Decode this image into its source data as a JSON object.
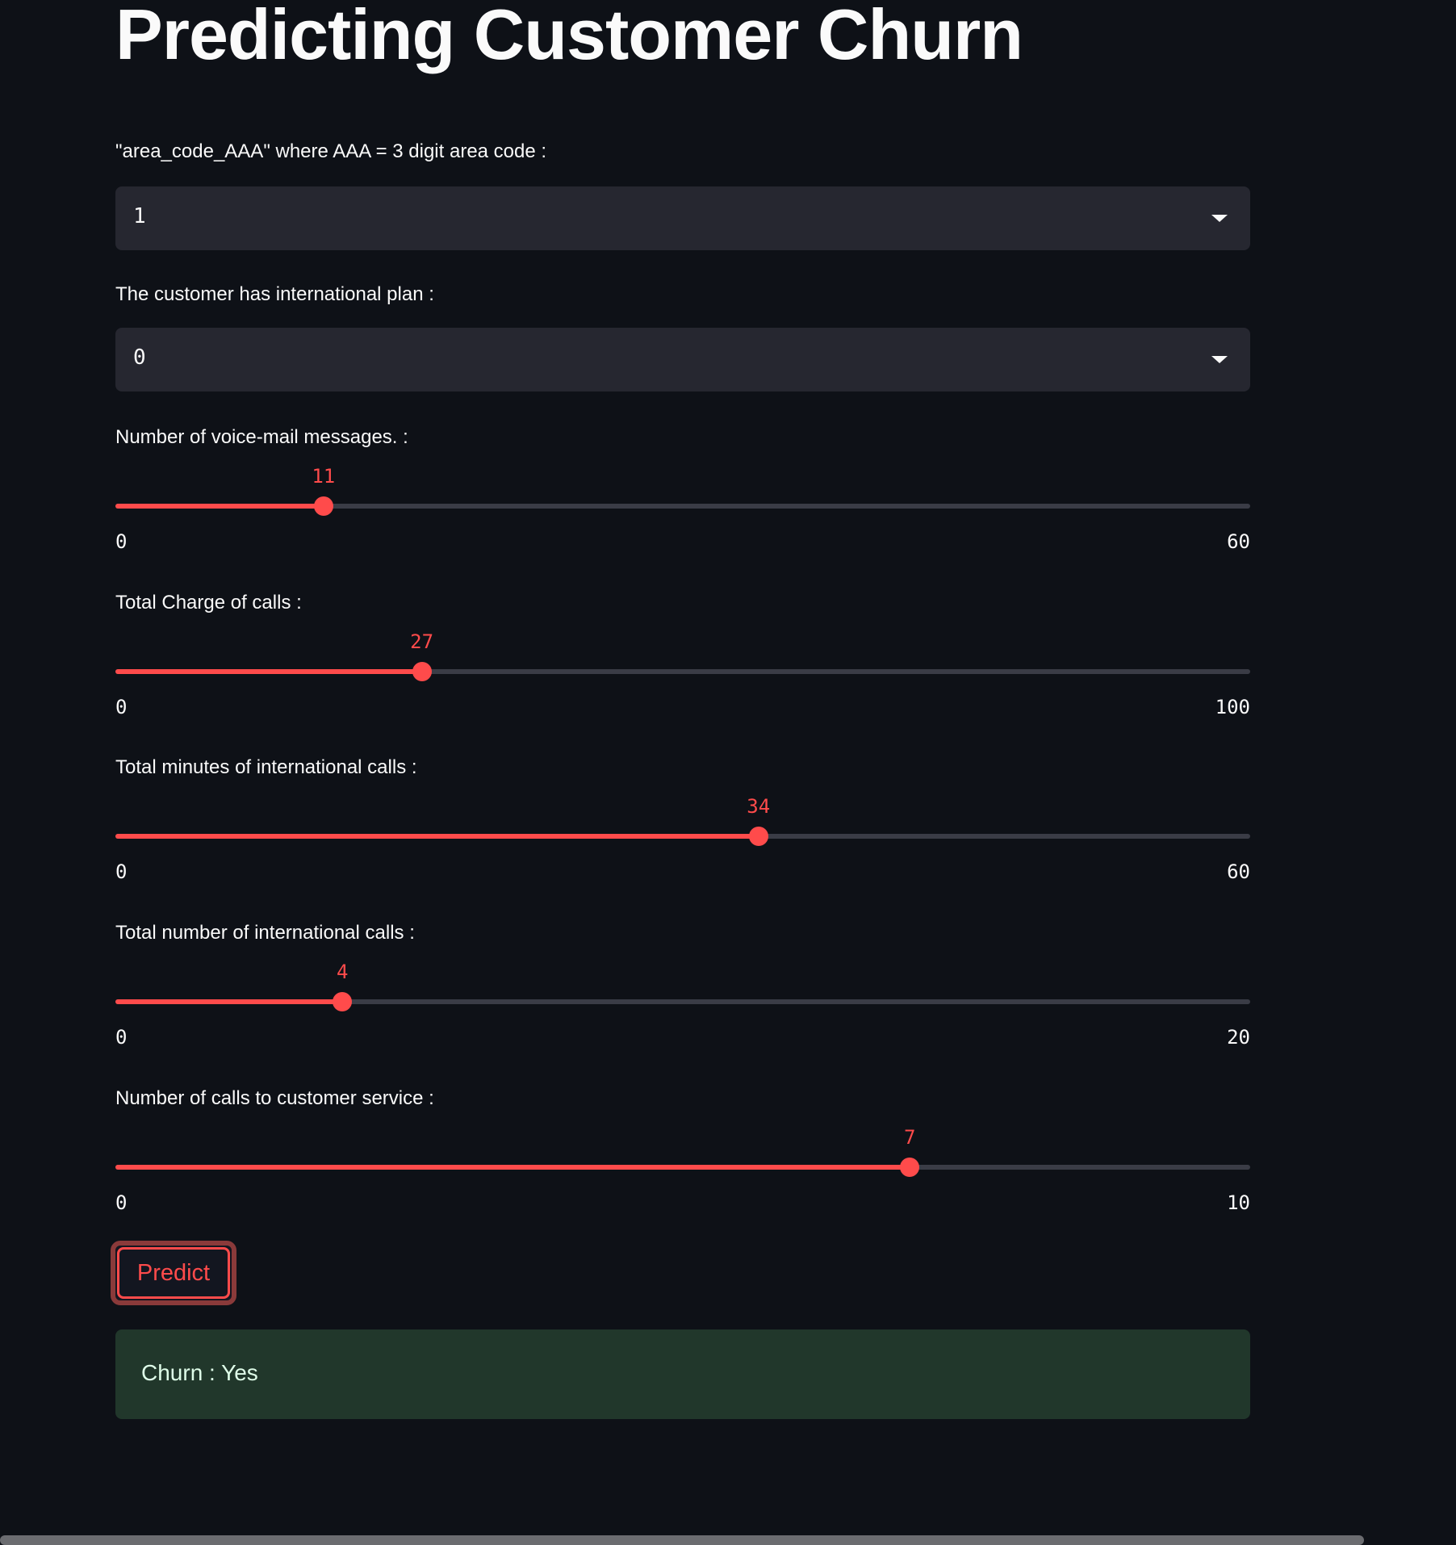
{
  "title": "Predicting Customer Churn",
  "selects": [
    {
      "label": "\"area_code_AAA\" where AAA = 3 digit area code :",
      "value": "1"
    },
    {
      "label": "The customer has international plan :",
      "value": "0"
    }
  ],
  "sliders": [
    {
      "label": "Number of voice-mail messages. :",
      "value": 11,
      "min": 0,
      "max": 60
    },
    {
      "label": "Total Charge of calls :",
      "value": 27,
      "min": 0,
      "max": 100
    },
    {
      "label": "Total minutes of international calls :",
      "value": 34,
      "min": 0,
      "max": 60
    },
    {
      "label": "Total number of international calls :",
      "value": 4,
      "min": 0,
      "max": 20
    },
    {
      "label": "Number of calls to customer service :",
      "value": 7,
      "min": 0,
      "max": 10
    }
  ],
  "predict_label": "Predict",
  "result": "Churn : Yes",
  "colors": {
    "accent": "#ff4b4b",
    "background": "#0e1117",
    "success_bg": "#21372b"
  }
}
